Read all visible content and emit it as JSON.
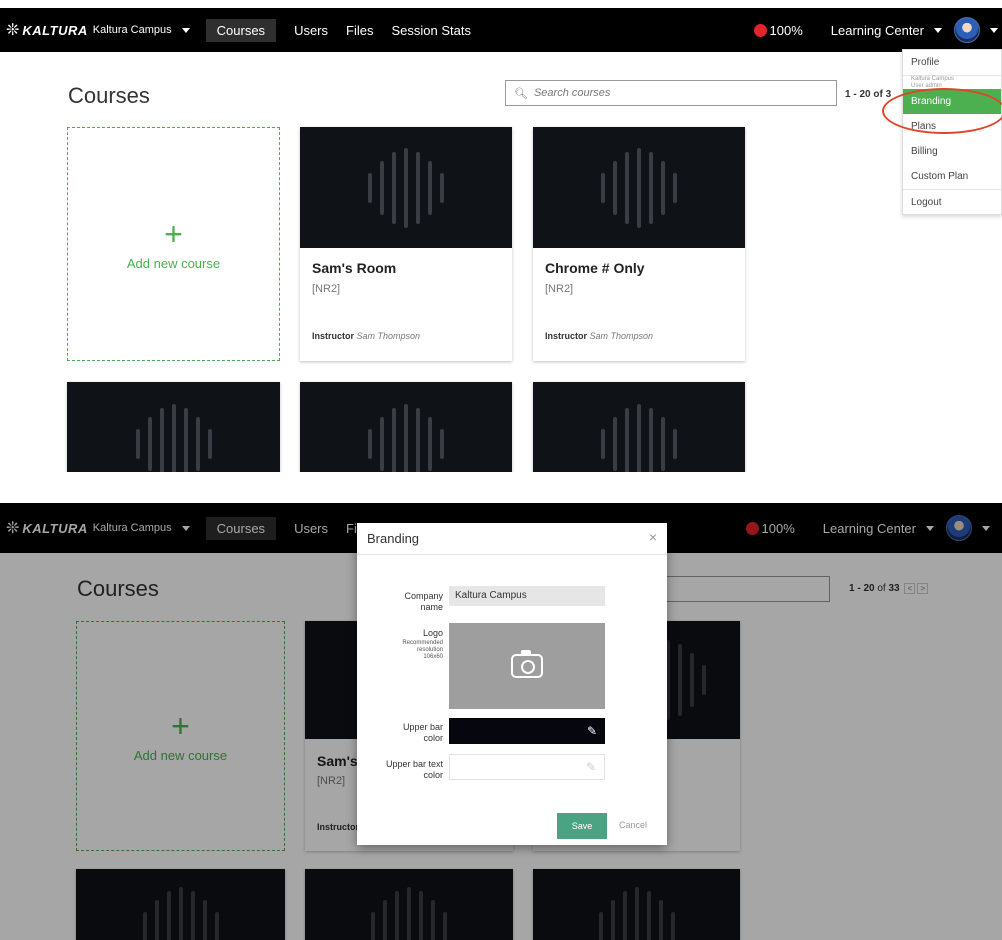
{
  "nav": {
    "brand": "KALTURA",
    "partner": "Kaltura Campus",
    "items": [
      "Courses",
      "Users",
      "Files",
      "Session Stats"
    ],
    "battery": "100%",
    "learning_center": "Learning Center"
  },
  "page": {
    "title": "Courses",
    "search_placeholder": "Search courses",
    "range_short": "1 - 20 of 3",
    "range_bold": "1 - 20",
    "range_of": "of",
    "range_total": "33",
    "pager_prev": "<",
    "pager_next": ">"
  },
  "add_course": {
    "plus": "+",
    "label": "Add new course"
  },
  "courses": [
    {
      "title": "Sam's Room",
      "code": "[NR2]",
      "instructor_label": "Instructor",
      "instructor": "Sam Thompson"
    },
    {
      "title": "Chrome # Only",
      "code": "[NR2]",
      "instructor_label": "Instructor",
      "instructor": "Sam Thompson"
    }
  ],
  "shot2_card": {
    "title": "Sam's",
    "code": "[NR2]",
    "instructor_label": "Instructor"
  },
  "user_menu": {
    "profile": "Profile",
    "partner": "Kaltura Campus",
    "role": "User admin",
    "branding": "Branding",
    "plans": "Plans",
    "billing": "Billing",
    "custom_plan": "Custom Plan",
    "logout": "Logout"
  },
  "branding_modal": {
    "title": "Branding",
    "close": "×",
    "company_label_1": "Company",
    "company_label_2": "name",
    "company_value": "Kaltura Campus",
    "logo_label": "Logo",
    "logo_hint_1": "Recommended",
    "logo_hint_2": "resolution",
    "logo_hint_3": "106x60",
    "upper_bar_label_1": "Upper bar",
    "upper_bar_label_2": "color",
    "upper_bar_color": "#000000",
    "upper_text_label_1": "Upper bar text",
    "upper_text_label_2": "color",
    "upper_text_color": "#ffffff",
    "save": "Save",
    "cancel": "Cancel"
  },
  "colors": {
    "accent": "#4caf50",
    "save": "#4aa483",
    "record": "#e3242b",
    "highlight": "#e0452a"
  }
}
